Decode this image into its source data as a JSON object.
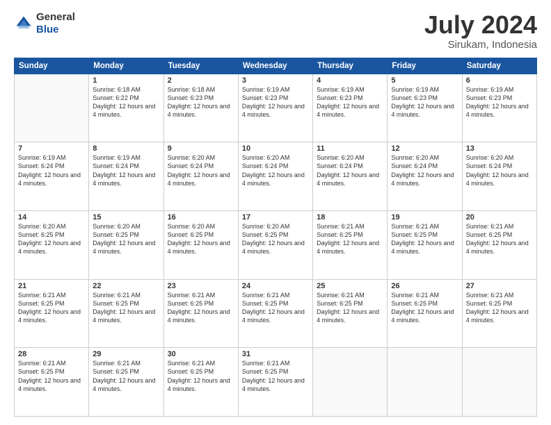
{
  "header": {
    "logo_general": "General",
    "logo_blue": "Blue",
    "month_year": "July 2024",
    "location": "Sirukam, Indonesia"
  },
  "columns": [
    "Sunday",
    "Monday",
    "Tuesday",
    "Wednesday",
    "Thursday",
    "Friday",
    "Saturday"
  ],
  "weeks": [
    [
      {
        "day": "",
        "sunrise": "",
        "sunset": "",
        "daylight": ""
      },
      {
        "day": "1",
        "sunrise": "Sunrise: 6:18 AM",
        "sunset": "Sunset: 6:22 PM",
        "daylight": "Daylight: 12 hours and 4 minutes."
      },
      {
        "day": "2",
        "sunrise": "Sunrise: 6:18 AM",
        "sunset": "Sunset: 6:23 PM",
        "daylight": "Daylight: 12 hours and 4 minutes."
      },
      {
        "day": "3",
        "sunrise": "Sunrise: 6:19 AM",
        "sunset": "Sunset: 6:23 PM",
        "daylight": "Daylight: 12 hours and 4 minutes."
      },
      {
        "day": "4",
        "sunrise": "Sunrise: 6:19 AM",
        "sunset": "Sunset: 6:23 PM",
        "daylight": "Daylight: 12 hours and 4 minutes."
      },
      {
        "day": "5",
        "sunrise": "Sunrise: 6:19 AM",
        "sunset": "Sunset: 6:23 PM",
        "daylight": "Daylight: 12 hours and 4 minutes."
      },
      {
        "day": "6",
        "sunrise": "Sunrise: 6:19 AM",
        "sunset": "Sunset: 6:23 PM",
        "daylight": "Daylight: 12 hours and 4 minutes."
      }
    ],
    [
      {
        "day": "7",
        "sunrise": "Sunrise: 6:19 AM",
        "sunset": "Sunset: 6:24 PM",
        "daylight": "Daylight: 12 hours and 4 minutes."
      },
      {
        "day": "8",
        "sunrise": "Sunrise: 6:19 AM",
        "sunset": "Sunset: 6:24 PM",
        "daylight": "Daylight: 12 hours and 4 minutes."
      },
      {
        "day": "9",
        "sunrise": "Sunrise: 6:20 AM",
        "sunset": "Sunset: 6:24 PM",
        "daylight": "Daylight: 12 hours and 4 minutes."
      },
      {
        "day": "10",
        "sunrise": "Sunrise: 6:20 AM",
        "sunset": "Sunset: 6:24 PM",
        "daylight": "Daylight: 12 hours and 4 minutes."
      },
      {
        "day": "11",
        "sunrise": "Sunrise: 6:20 AM",
        "sunset": "Sunset: 6:24 PM",
        "daylight": "Daylight: 12 hours and 4 minutes."
      },
      {
        "day": "12",
        "sunrise": "Sunrise: 6:20 AM",
        "sunset": "Sunset: 6:24 PM",
        "daylight": "Daylight: 12 hours and 4 minutes."
      },
      {
        "day": "13",
        "sunrise": "Sunrise: 6:20 AM",
        "sunset": "Sunset: 6:24 PM",
        "daylight": "Daylight: 12 hours and 4 minutes."
      }
    ],
    [
      {
        "day": "14",
        "sunrise": "Sunrise: 6:20 AM",
        "sunset": "Sunset: 6:25 PM",
        "daylight": "Daylight: 12 hours and 4 minutes."
      },
      {
        "day": "15",
        "sunrise": "Sunrise: 6:20 AM",
        "sunset": "Sunset: 6:25 PM",
        "daylight": "Daylight: 12 hours and 4 minutes."
      },
      {
        "day": "16",
        "sunrise": "Sunrise: 6:20 AM",
        "sunset": "Sunset: 6:25 PM",
        "daylight": "Daylight: 12 hours and 4 minutes."
      },
      {
        "day": "17",
        "sunrise": "Sunrise: 6:20 AM",
        "sunset": "Sunset: 6:25 PM",
        "daylight": "Daylight: 12 hours and 4 minutes."
      },
      {
        "day": "18",
        "sunrise": "Sunrise: 6:21 AM",
        "sunset": "Sunset: 6:25 PM",
        "daylight": "Daylight: 12 hours and 4 minutes."
      },
      {
        "day": "19",
        "sunrise": "Sunrise: 6:21 AM",
        "sunset": "Sunset: 6:25 PM",
        "daylight": "Daylight: 12 hours and 4 minutes."
      },
      {
        "day": "20",
        "sunrise": "Sunrise: 6:21 AM",
        "sunset": "Sunset: 6:25 PM",
        "daylight": "Daylight: 12 hours and 4 minutes."
      }
    ],
    [
      {
        "day": "21",
        "sunrise": "Sunrise: 6:21 AM",
        "sunset": "Sunset: 6:25 PM",
        "daylight": "Daylight: 12 hours and 4 minutes."
      },
      {
        "day": "22",
        "sunrise": "Sunrise: 6:21 AM",
        "sunset": "Sunset: 6:25 PM",
        "daylight": "Daylight: 12 hours and 4 minutes."
      },
      {
        "day": "23",
        "sunrise": "Sunrise: 6:21 AM",
        "sunset": "Sunset: 6:25 PM",
        "daylight": "Daylight: 12 hours and 4 minutes."
      },
      {
        "day": "24",
        "sunrise": "Sunrise: 6:21 AM",
        "sunset": "Sunset: 6:25 PM",
        "daylight": "Daylight: 12 hours and 4 minutes."
      },
      {
        "day": "25",
        "sunrise": "Sunrise: 6:21 AM",
        "sunset": "Sunset: 6:25 PM",
        "daylight": "Daylight: 12 hours and 4 minutes."
      },
      {
        "day": "26",
        "sunrise": "Sunrise: 6:21 AM",
        "sunset": "Sunset: 6:25 PM",
        "daylight": "Daylight: 12 hours and 4 minutes."
      },
      {
        "day": "27",
        "sunrise": "Sunrise: 6:21 AM",
        "sunset": "Sunset: 6:25 PM",
        "daylight": "Daylight: 12 hours and 4 minutes."
      }
    ],
    [
      {
        "day": "28",
        "sunrise": "Sunrise: 6:21 AM",
        "sunset": "Sunset: 6:25 PM",
        "daylight": "Daylight: 12 hours and 4 minutes."
      },
      {
        "day": "29",
        "sunrise": "Sunrise: 6:21 AM",
        "sunset": "Sunset: 6:25 PM",
        "daylight": "Daylight: 12 hours and 4 minutes."
      },
      {
        "day": "30",
        "sunrise": "Sunrise: 6:21 AM",
        "sunset": "Sunset: 6:25 PM",
        "daylight": "Daylight: 12 hours and 4 minutes."
      },
      {
        "day": "31",
        "sunrise": "Sunrise: 6:21 AM",
        "sunset": "Sunset: 6:25 PM",
        "daylight": "Daylight: 12 hours and 4 minutes."
      },
      {
        "day": "",
        "sunrise": "",
        "sunset": "",
        "daylight": ""
      },
      {
        "day": "",
        "sunrise": "",
        "sunset": "",
        "daylight": ""
      },
      {
        "day": "",
        "sunrise": "",
        "sunset": "",
        "daylight": ""
      }
    ]
  ]
}
